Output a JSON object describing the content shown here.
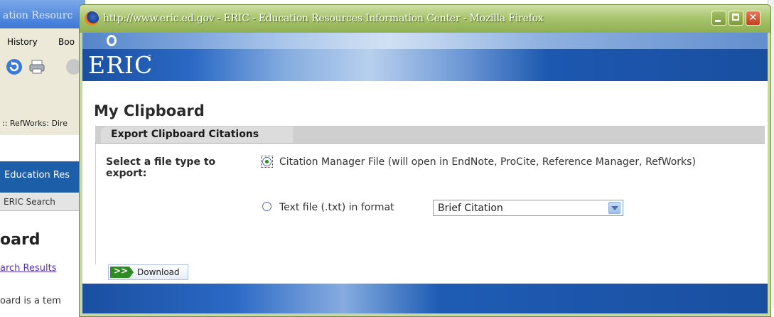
{
  "background": {
    "title_fragment": "ation Resourc",
    "menu": [
      "History",
      "Boo"
    ],
    "tab_label": ":: RefWorks: Dire",
    "eric_band": "Education Res",
    "search_tab": "ERIC Search",
    "heading_fragment": "oard",
    "link_fragment": "arch Results",
    "text_fragment": "oard is a tem"
  },
  "window": {
    "title": "http://www.eric.ed.gov - ERIC - Education Resources Information Center - Mozilla Firefox",
    "controls": [
      "minimize",
      "maximize",
      "close"
    ]
  },
  "banner": {
    "logo": "ERIC",
    "trademark": "™"
  },
  "page": {
    "title": "My Clipboard",
    "section_title": "Export Clipboard Citations",
    "field_label": "Select a file type to export:",
    "option_manager": "Citation Manager File (will open in EndNote, ProCite, Reference Manager, RefWorks)",
    "option_manager_selected": true,
    "option_text": "Text file (.txt) in format",
    "format_select": "Brief Citation",
    "download_label": "Download",
    "download_arrow": ">>"
  }
}
